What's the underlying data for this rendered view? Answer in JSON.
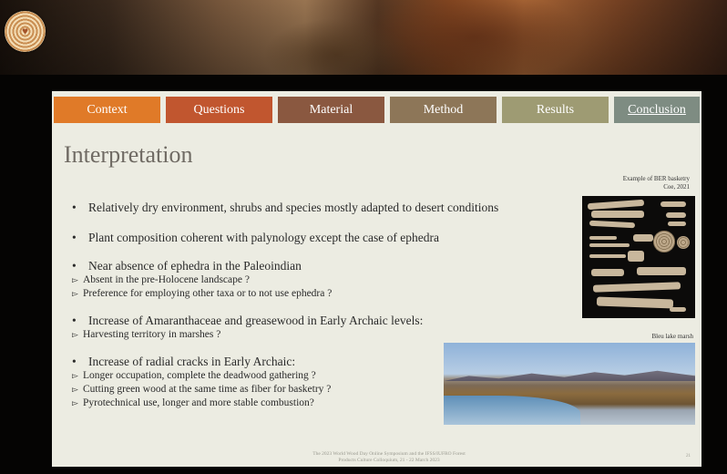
{
  "nav": {
    "tabs": [
      {
        "label": "Context",
        "color": "#e07a28"
      },
      {
        "label": "Questions",
        "color": "#c1562f"
      },
      {
        "label": "Material",
        "color": "#8a5840"
      },
      {
        "label": "Method",
        "color": "#8d7658"
      },
      {
        "label": "Results",
        "color": "#9e9b73"
      },
      {
        "label": "Conclusion",
        "color": "#7e8c82",
        "active": true
      }
    ]
  },
  "slide": {
    "title": "Interpretation",
    "bullets": [
      {
        "text": "Relatively dry environment, shrubs and species mostly adapted to desert conditions"
      },
      {
        "text": "Plant composition coherent with palynology except the case of ephedra"
      },
      {
        "text": "Near absence of ephedra in the Paleoindian"
      },
      {
        "text": "Increase of Amaranthaceae and greasewood in Early Archaic levels:"
      },
      {
        "text": "Increase of radial cracks in Early Archaic:"
      }
    ],
    "subs": [
      {
        "text": "Absent in the pre-Holocene landscape ?"
      },
      {
        "text": "Preference for employing other taxa or to not use ephedra ?"
      },
      {
        "text": "Harvesting territory in marshes ?"
      },
      {
        "text": "Longer occupation, complete the deadwood gathering ?"
      },
      {
        "text": "Cutting green wood at the same time as fiber for basketry ?"
      },
      {
        "text": "Pyrotechnical use, longer  and more stable combustion?"
      }
    ],
    "bullet_glyph": "•",
    "sub_glyph": "▻",
    "captions": {
      "basketry_line1": "Example of BER basketry",
      "basketry_line2": "Coe, 2021",
      "marsh": "Bleu lake marsh"
    },
    "footer": {
      "line1": "The 2023 World Wood Day Online Symposium and the IFSS/IUFRO Forest",
      "line2": "Products Culture Colloquium, 21 - 22 March 2023"
    },
    "page_number": "21"
  }
}
